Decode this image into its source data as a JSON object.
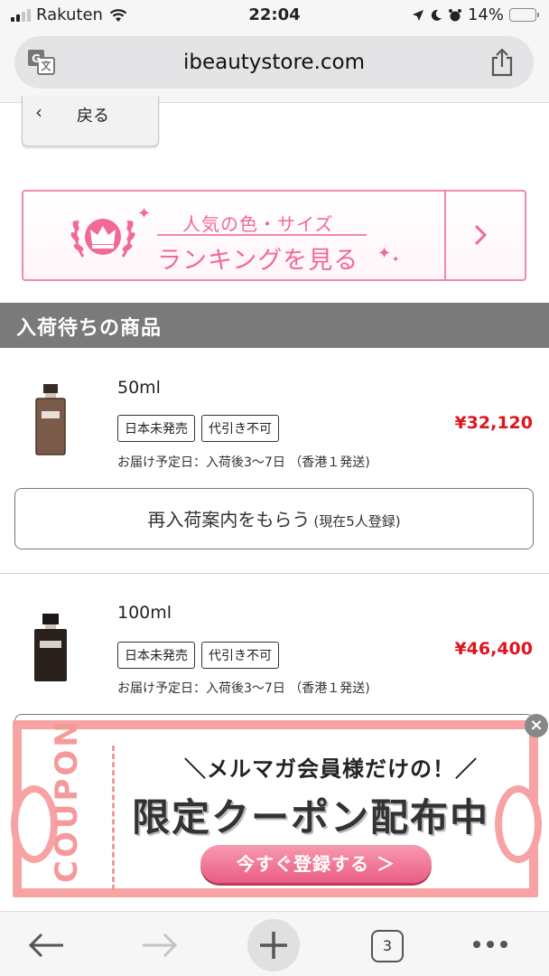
{
  "status_bar": {
    "carrier": "Rakuten",
    "time": "22:04",
    "battery": "14%",
    "battery_level": 0.14
  },
  "browser": {
    "url": "ibeautystore.com"
  },
  "back_button": {
    "label": "戻る"
  },
  "ranking_banner": {
    "line1": "人気の色・サイズ",
    "line2": "ランキングを見る"
  },
  "section": {
    "title": "入荷待ちの商品"
  },
  "products": [
    {
      "volume": "50ml",
      "tags": [
        "日本未発売",
        "代引き不可"
      ],
      "price": "¥32,120",
      "eta": "お届け予定日：入荷後3〜7日 （香港１発送)",
      "notify_label": "再入荷案内をもらう",
      "notify_sub": "(現在5人登録)"
    },
    {
      "volume": "100ml",
      "tags": [
        "日本未発売",
        "代引き不可"
      ],
      "price": "¥46,400",
      "eta": "お届け予定日：入荷後3〜7日 （香港１発送)"
    }
  ],
  "coupon": {
    "vertical_label": "COUPON",
    "line1": "＼メルマガ会員様だけの！／",
    "line2": "限定クーポン配布中",
    "button_label": "今すぐ登録する ＞",
    "close_label": "×"
  },
  "toolbar": {
    "tabs_count": "3"
  },
  "colors": {
    "accent_pink": "#f06a95",
    "price_red": "#e0141e",
    "coupon_border": "#f7a3a3",
    "section_gray": "#7a7a7a"
  }
}
